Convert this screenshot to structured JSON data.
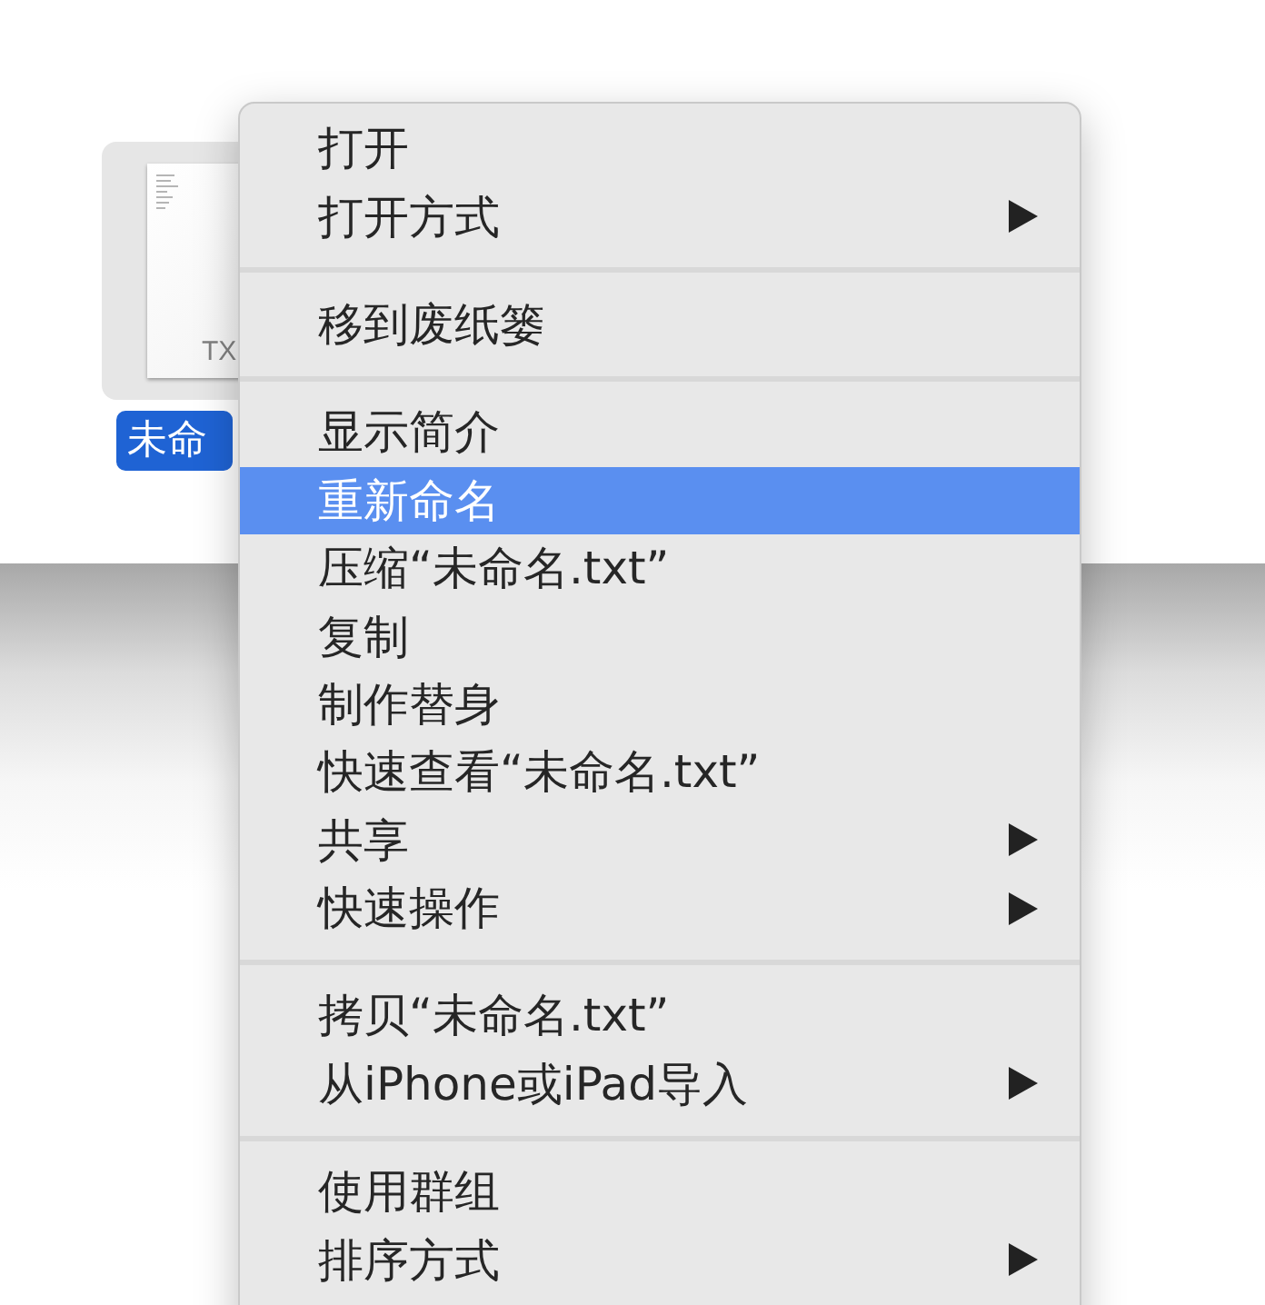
{
  "file": {
    "type_label": "TX",
    "name": "未命",
    "selected": true
  },
  "menu": {
    "items": [
      {
        "kind": "item",
        "label": "打开",
        "selected": false,
        "submenu": false
      },
      {
        "kind": "item",
        "label": "打开方式",
        "selected": false,
        "submenu": true
      },
      {
        "kind": "separator"
      },
      {
        "kind": "item",
        "label": "移到废纸篓",
        "selected": false,
        "submenu": false
      },
      {
        "kind": "separator"
      },
      {
        "kind": "item",
        "label": "显示简介",
        "selected": false,
        "submenu": false
      },
      {
        "kind": "item",
        "label": "重新命名",
        "selected": true,
        "submenu": false
      },
      {
        "kind": "item",
        "label": "压缩“未命名.txt”",
        "selected": false,
        "submenu": false
      },
      {
        "kind": "item",
        "label": "复制",
        "selected": false,
        "submenu": false
      },
      {
        "kind": "item",
        "label": "制作替身",
        "selected": false,
        "submenu": false
      },
      {
        "kind": "item",
        "label": "快速查看“未命名.txt”",
        "selected": false,
        "submenu": false
      },
      {
        "kind": "item",
        "label": "共享",
        "selected": false,
        "submenu": true
      },
      {
        "kind": "item",
        "label": "快速操作",
        "selected": false,
        "submenu": true
      },
      {
        "kind": "separator"
      },
      {
        "kind": "item",
        "label": "拷贝“未命名.txt”",
        "selected": false,
        "submenu": false
      },
      {
        "kind": "item",
        "label": "从iPhone或iPad导入",
        "selected": false,
        "submenu": true
      },
      {
        "kind": "separator"
      },
      {
        "kind": "item",
        "label": "使用群组",
        "selected": false,
        "submenu": false
      },
      {
        "kind": "item",
        "label": "排序方式",
        "selected": false,
        "submenu": true
      }
    ]
  }
}
